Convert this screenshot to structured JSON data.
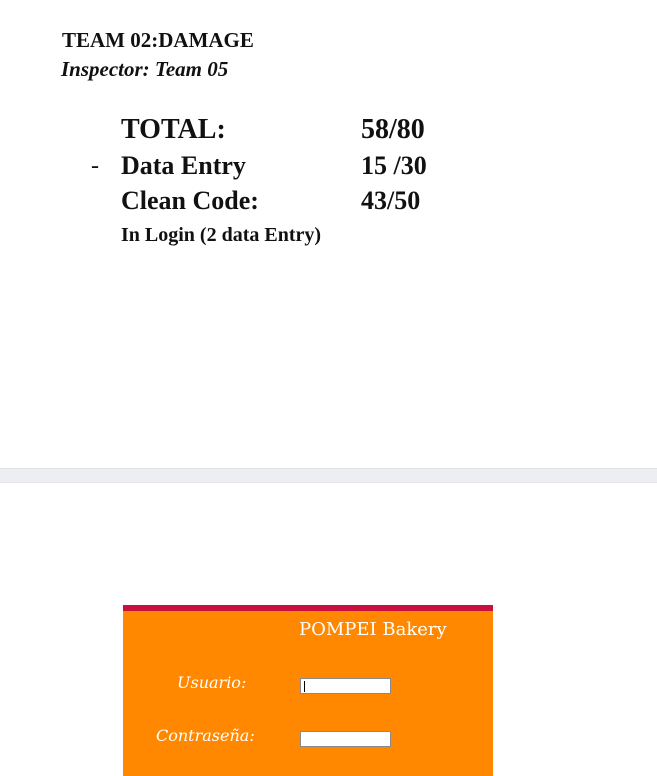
{
  "report": {
    "title": "TEAM 02:DAMAGE",
    "inspector": "Inspector: Team 05",
    "scores": [
      {
        "label": "TOTAL:",
        "value": "58/80"
      },
      {
        "label": "Data Entry",
        "value": "15 /30"
      },
      {
        "label": "Clean Code:",
        "value": "43/50"
      }
    ],
    "bullet": "-",
    "note": "In Login (2 data Entry)"
  },
  "login": {
    "brand": "POMPEI Bakery",
    "user_label": "Usuario:",
    "user_value": "",
    "pass_label": "Contraseña:",
    "pass_value": "",
    "colors": {
      "panel": "#ff8800",
      "top_border": "#c8103f",
      "text": "#ffffff"
    }
  }
}
